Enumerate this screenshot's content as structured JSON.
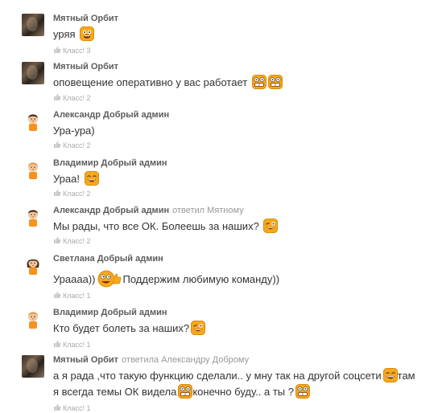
{
  "comments": [
    {
      "author": "Мятный Орбит",
      "reply_to": "",
      "text": "уряя",
      "likes": "Класс! 3",
      "avatar": "photo"
    },
    {
      "author": "Мятный Орбит",
      "reply_to": "",
      "text": "оповещение оперативно у вас работает",
      "likes": "Класс! 2",
      "avatar": "photo"
    },
    {
      "author": "Александр Добрый админ",
      "reply_to": "",
      "text": "Ура-ура)",
      "likes": "Класс! 2",
      "avatar": "boy-dark"
    },
    {
      "author": "Владимир Добрый админ",
      "reply_to": "",
      "text": "Ураа!",
      "likes": "Класс! 2",
      "avatar": "boy-light"
    },
    {
      "author": "Александр Добрый админ",
      "reply_to": "ответил Мятному",
      "text": "Мы рады, что все ОК. Болеешь за наших?",
      "likes": "Класс! 2",
      "avatar": "boy-dark"
    },
    {
      "author": "Светлана Добрый админ",
      "reply_to": "",
      "text_parts": [
        "Ураааа))",
        "Поддержим любимую команду))"
      ],
      "likes": "Класс! 1",
      "avatar": "girl"
    },
    {
      "author": "Владимир Добрый админ",
      "reply_to": "",
      "text": "Кто будет болеть за наших?",
      "likes": "Класс! 1",
      "avatar": "boy-light"
    },
    {
      "author": "Мятный Орбит",
      "reply_to": "ответила Александру Доброму",
      "text_parts": [
        "а я рада ,что такую функцию сделали.. у мну так на другой соцсети",
        "там я всегда темы ОК видела",
        "конечно буду.. а ты ?"
      ],
      "likes": "Класс! 1",
      "avatar": "photo"
    }
  ],
  "colors": {
    "emoji_fill": "#f7a81b",
    "text": "#333333",
    "muted": "#a9a9a9"
  }
}
